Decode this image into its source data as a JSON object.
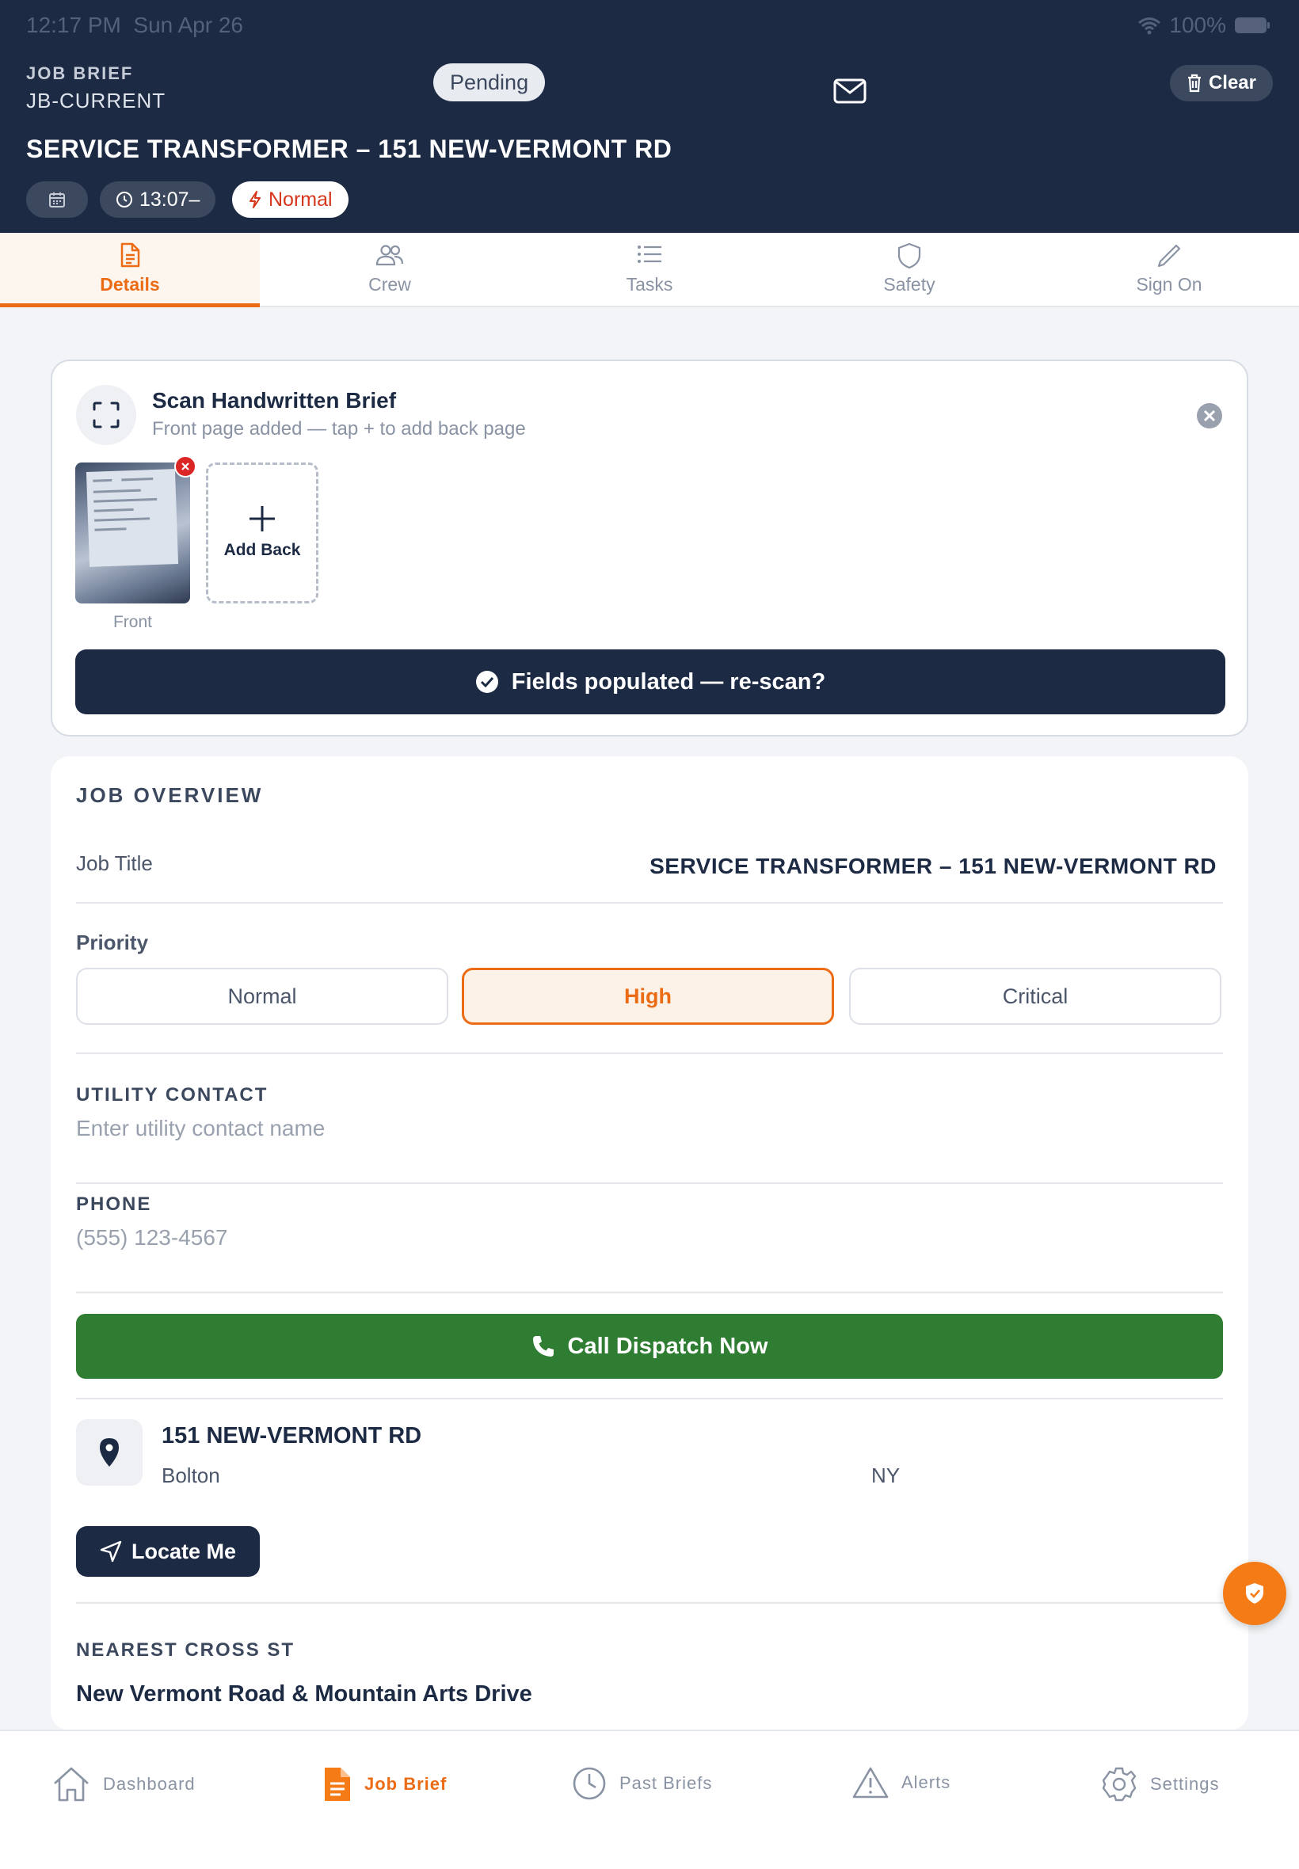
{
  "status_bar": {
    "time": "12:17 PM",
    "date": "Sun Apr 26",
    "battery": "100%"
  },
  "header": {
    "label": "JOB BRIEF",
    "id": "JB-CURRENT",
    "status": "Pending",
    "clear_label": "Clear",
    "title": "SERVICE TRANSFORMER – 151 NEW-VERMONT RD",
    "time_chip": "13:07–",
    "priority_chip": "Normal"
  },
  "tabs": [
    {
      "label": "Details",
      "icon": "document-icon",
      "active": true
    },
    {
      "label": "Crew",
      "icon": "users-icon"
    },
    {
      "label": "Tasks",
      "icon": "list-icon"
    },
    {
      "label": "Safety",
      "icon": "shield-icon"
    },
    {
      "label": "Sign On",
      "icon": "pen-icon"
    }
  ],
  "scan": {
    "title": "Scan Handwritten Brief",
    "subtitle": "Front page added — tap + to add back page",
    "front_label": "Front",
    "add_back_label": "Add Back",
    "button_label": "Fields populated — re-scan?"
  },
  "overview": {
    "section_title": "JOB OVERVIEW",
    "job_title_label": "Job Title",
    "job_title_value": "SERVICE TRANSFORMER – 151 NEW-VERMONT RD",
    "priority_label": "Priority",
    "priority_options": [
      "Normal",
      "High",
      "Critical"
    ],
    "priority_selected": "High",
    "utility_contact_label": "UTILITY CONTACT",
    "utility_contact_placeholder": "Enter utility contact name",
    "phone_label": "PHONE",
    "phone_placeholder": "(555) 123-4567",
    "call_button": "Call Dispatch Now",
    "address_street": "151 NEW-VERMONT RD",
    "address_city": "Bolton",
    "address_state": "NY",
    "locate_button": "Locate Me",
    "cross_label": "NEAREST CROSS ST",
    "cross_value": "New Vermont Road & Mountain Arts Drive"
  },
  "bottom_nav": [
    {
      "label": "Dashboard",
      "icon": "home-icon"
    },
    {
      "label": "Job Brief",
      "icon": "file-icon",
      "active": true
    },
    {
      "label": "Past Briefs",
      "icon": "clock-icon"
    },
    {
      "label": "Alerts",
      "icon": "warning-icon"
    },
    {
      "label": "Settings",
      "icon": "gear-icon"
    }
  ],
  "colors": {
    "navy": "#1c2a44",
    "accent": "#ec6c16",
    "green": "#2e7d32",
    "danger": "#dc2626"
  }
}
